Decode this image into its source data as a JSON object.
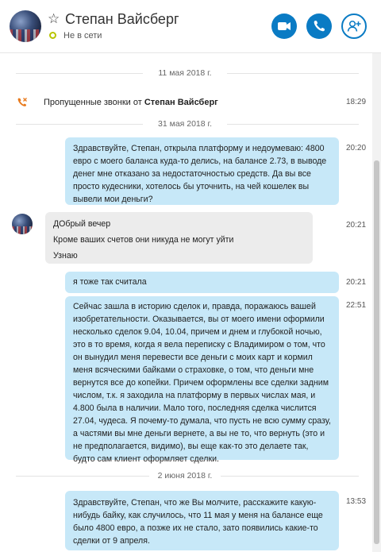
{
  "header": {
    "contact_name": "Степан Вайсберг",
    "status": "Не в сети",
    "accent_color": "#0a7bc4",
    "status_color": "#b8c400",
    "icons": [
      "star-icon",
      "video-call-icon",
      "phone-icon",
      "add-person-icon"
    ]
  },
  "chat": {
    "date1": "11 мая 2018 г.",
    "missed_prefix": "Пропущенные звонки от",
    "missed_name": "Степан Вайсберг",
    "missed_time": "18:29",
    "date2": "31 мая 2018 г.",
    "msg1_text": "Здравствуйте, Степан, открыла платформу и недоумеваю: 4800 евро с моего баланса куда-то делись, на балансе 2.73, в выводе денег мне отказано за недостаточностью средств. Да вы все просто кудесники, хотелось бы уточнить, на чей кошелек вы вывели мои деньги?",
    "msg1_time": "20:20",
    "msg2_line1": "ДОбрый вечер",
    "msg2_line2": "Кроме ваших счетов они никуда не могут уйти",
    "msg2_line3": "Узнаю",
    "msg2_time": "20:21",
    "msg3_text": "я тоже так считала",
    "msg3_time": "20:21",
    "msg4_text": "Сейчас зашла в историю сделок и, правда, поражаюсь вашей изобретательности. Оказывается, вы от моего имени оформили несколько сделок 9.04, 10.04, причем и днем и глубокой ночью, это в то время, когда я вела переписку с Владимиром о том, что он вынудил меня перевести все деньги с моих карт и кормил меня всяческими байками о страховке, о том, что деньги мне вернутся все до копейки. Причем оформлены все сделки задним числом, т.к. я заходила на платформу в первых числах мая, и 4.800 была в наличии. Мало того, последняя сделка числится 27.04, чудеса. Я почему-то думала, что пусть не всю сумму сразу, а частями вы мне деньги вернете, а вы не то, что вернуть (это и не предполагается, видимо), вы еще как-то это делаете так, будто сам клиент оформляет сделки.",
    "msg4_time": "22:51",
    "date3": "2 июня 2018 г.",
    "msg5_text": "Здравствуйте, Степан, что же Вы молчите, расскажите какую-нибудь байку, как случилось, что 11 мая у меня на балансе еще было 4800 евро, а позже их не стало, зато появились какие-то сделки от 9 апреля.",
    "msg5_time": "13:53"
  }
}
